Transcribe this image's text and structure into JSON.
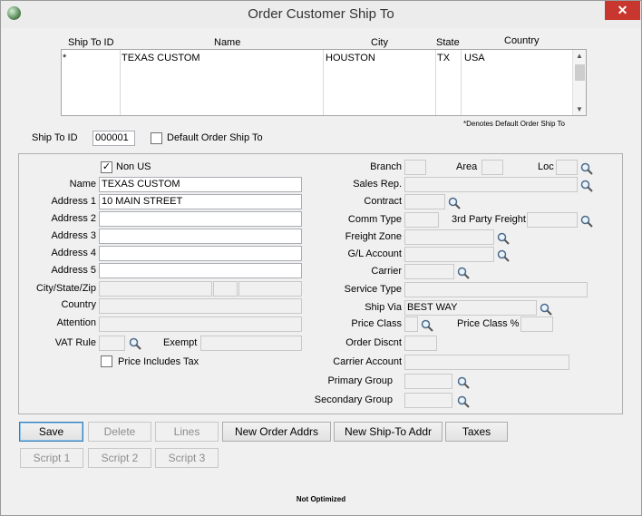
{
  "window": {
    "title": "Order Customer Ship To",
    "close": "✕"
  },
  "grid": {
    "headers": {
      "id": "Ship To ID",
      "name": "Name",
      "city": "City",
      "state": "State",
      "country": "Country"
    },
    "rows": [
      {
        "id": "*",
        "name": "TEXAS CUSTOM",
        "city": "HOUSTON",
        "state": "TX",
        "country": "USA"
      }
    ],
    "note": "*Denotes Default Order Ship To"
  },
  "top": {
    "ship_to_id_label": "Ship To ID",
    "ship_to_id_value": "000001",
    "default_label": "Default Order Ship To",
    "default_checked": false
  },
  "left": {
    "non_us_label": "Non US",
    "non_us_checked": true,
    "name_label": "Name",
    "name_value": "TEXAS CUSTOM",
    "addr1_label": "Address 1",
    "addr1_value": "10 MAIN STREET",
    "addr2_label": "Address 2",
    "addr2_value": "",
    "addr3_label": "Address 3",
    "addr3_value": "",
    "addr4_label": "Address 4",
    "addr4_value": "",
    "addr5_label": "Address 5",
    "addr5_value": "",
    "csz_label": "City/State/Zip",
    "country_label": "Country",
    "attention_label": "Attention",
    "vat_label": "VAT Rule",
    "exempt_label": "Exempt",
    "price_tax_label": "Price Includes Tax",
    "price_tax_checked": false
  },
  "right": {
    "branch_label": "Branch",
    "area_label": "Area",
    "loc_label": "Loc",
    "salesrep_label": "Sales Rep.",
    "contract_label": "Contract",
    "commtype_label": "Comm Type",
    "thirdparty_label": "3rd Party Freight",
    "freightzone_label": "Freight Zone",
    "gl_label": "G/L Account",
    "carrier_label": "Carrier",
    "service_label": "Service Type",
    "shipvia_label": "Ship Via",
    "shipvia_value": "BEST WAY",
    "priceclass_label": "Price Class",
    "priceclasspct_label": "Price Class %",
    "orderdisc_label": "Order Discnt",
    "carrieracct_label": "Carrier Account",
    "primary_label": "Primary Group",
    "secondary_label": "Secondary Group"
  },
  "buttons": {
    "save": "Save",
    "delete": "Delete",
    "lines": "Lines",
    "new_order": "New Order Addrs",
    "new_shipto": "New Ship-To Addr",
    "taxes": "Taxes",
    "script1": "Script 1",
    "script2": "Script 2",
    "script3": "Script 3"
  },
  "status": "Not Optimized",
  "icons": {
    "lookup": "magnifier-icon",
    "app": "app-globe-icon",
    "close": "close-icon"
  }
}
